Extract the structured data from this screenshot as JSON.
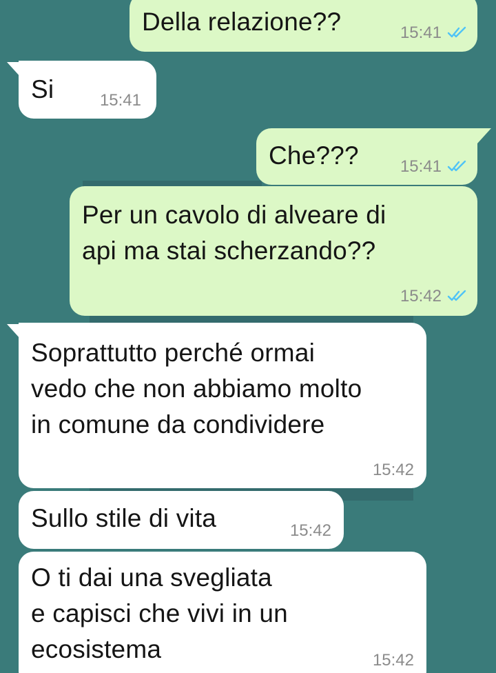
{
  "colors": {
    "background": "#3a7b7a",
    "outgoing_bubble": "#dcf8c6",
    "incoming_bubble": "#ffffff",
    "read_tick": "#4fc3f7",
    "timestamp": "#8b8b8b"
  },
  "messages": [
    {
      "direction": "outgoing",
      "text": "Della relazione??",
      "time": "15:41",
      "status_icon": "double-check-read-icon"
    },
    {
      "direction": "incoming",
      "text": "Si",
      "time": "15:41"
    },
    {
      "direction": "outgoing",
      "text": "Che???",
      "time": "15:41",
      "status_icon": "double-check-read-icon"
    },
    {
      "direction": "outgoing",
      "lines": [
        "Per un cavolo di alveare di",
        "api ma stai scherzando??"
      ],
      "time": "15:42",
      "status_icon": "double-check-read-icon"
    },
    {
      "direction": "incoming",
      "lines": [
        "Soprattutto perché ormai",
        "vedo che non abbiamo molto",
        "in comune da condividere"
      ],
      "time": "15:42"
    },
    {
      "direction": "incoming",
      "text": "Sullo stile di vita",
      "time": "15:42"
    },
    {
      "direction": "incoming",
      "lines": [
        "O ti dai una svegliata",
        "e capisci che vivi in un",
        "ecosistema"
      ],
      "time": "15:42"
    }
  ]
}
